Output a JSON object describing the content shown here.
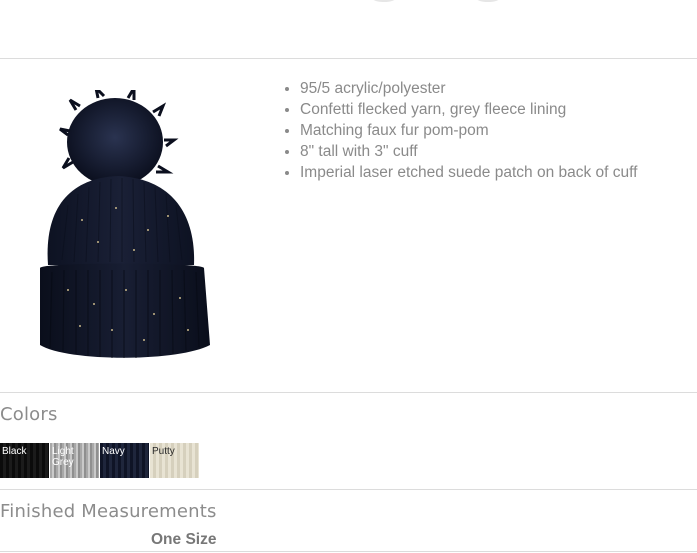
{
  "product": {
    "features": [
      "95/5 acrylic/polyester",
      "Confetti flecked yarn, grey fleece lining",
      "Matching faux fur pom-pom",
      "8\" tall with 3\" cuff",
      "Imperial laser etched suede patch on back of cuff"
    ],
    "image_icon": "beanie-hat-image"
  },
  "colors": {
    "title": "Colors",
    "swatches": [
      {
        "label": "Black",
        "color": "#111111"
      },
      {
        "label": "Light Grey",
        "color": "#b5b5b5"
      },
      {
        "label": "Navy",
        "color": "#161b2e"
      },
      {
        "label": "Putty",
        "color": "#e2dcc9"
      }
    ]
  },
  "measurements": {
    "title": "Finished Measurements",
    "size": "One Size"
  }
}
